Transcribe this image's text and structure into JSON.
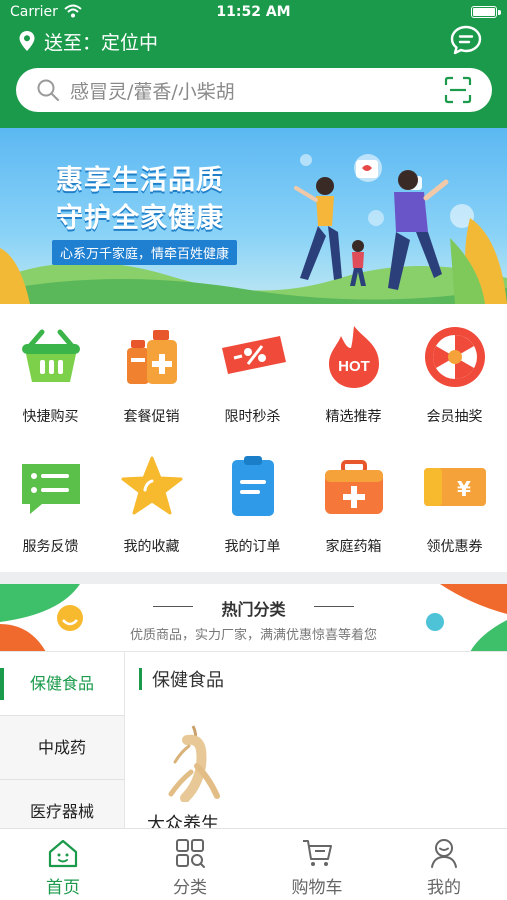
{
  "status_bar": {
    "carrier": "Carrier",
    "time": "11:52 AM"
  },
  "header": {
    "location_prefix": "送至：",
    "location_value": "定位中",
    "search_placeholder": "感冒灵/藿香/小柴胡"
  },
  "banner": {
    "title_line1": "惠享生活品质",
    "title_line2": "守护全家健康",
    "subtitle": "心系万千家庭，情牵百姓健康"
  },
  "quick_grid": [
    {
      "label": "快捷购买",
      "icon": "basket-icon"
    },
    {
      "label": "套餐促销",
      "icon": "bottles-icon"
    },
    {
      "label": "限时秒杀",
      "icon": "percent-ticket-icon"
    },
    {
      "label": "精选推荐",
      "icon": "hot-flame-icon"
    },
    {
      "label": "会员抽奖",
      "icon": "lottery-wheel-icon"
    },
    {
      "label": "服务反馈",
      "icon": "chat-list-icon"
    },
    {
      "label": "我的收藏",
      "icon": "star-icon"
    },
    {
      "label": "我的订单",
      "icon": "clipboard-icon"
    },
    {
      "label": "家庭药箱",
      "icon": "medicine-box-icon"
    },
    {
      "label": "领优惠券",
      "icon": "coupon-icon"
    }
  ],
  "hot_categories": {
    "title": "热门分类",
    "subtitle": "优质商品，实力厂家，满满优惠惊喜等着您"
  },
  "category_sidebar": [
    {
      "label": "保健食品",
      "active": true
    },
    {
      "label": "中成药",
      "active": false
    },
    {
      "label": "医疗器械",
      "active": false
    }
  ],
  "category_content": {
    "heading": "保健食品",
    "products": [
      {
        "name": "大众养生"
      }
    ]
  },
  "tabbar": [
    {
      "label": "首页",
      "icon": "home-icon",
      "active": true
    },
    {
      "label": "分类",
      "icon": "category-icon",
      "active": false
    },
    {
      "label": "购物车",
      "icon": "cart-icon",
      "active": false
    },
    {
      "label": "我的",
      "icon": "profile-icon",
      "active": false
    }
  ],
  "colors": {
    "primary": "#1a9a4a",
    "banner_sky": "#5cb8f2"
  }
}
